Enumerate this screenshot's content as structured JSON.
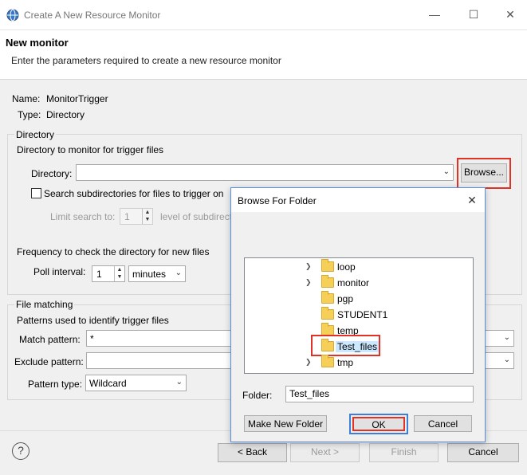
{
  "window": {
    "title": "Create A New Resource Monitor"
  },
  "header": {
    "title": "New monitor",
    "description": "Enter the parameters required to create a new resource monitor"
  },
  "info": {
    "name_label": "Name:",
    "name_value": "MonitorTrigger",
    "type_label": "Type:",
    "type_value": "Directory"
  },
  "directory": {
    "group_label": "Directory",
    "subtitle": "Directory to monitor for trigger files",
    "directory_label": "Directory:",
    "directory_value": "",
    "browse_label": "Browse...",
    "search_sub_label": "Search subdirectories for files to trigger on",
    "limit_label": "Limit search to:",
    "limit_value": "1",
    "level_label": "level of subdirect"
  },
  "frequency": {
    "subtitle": "Frequency to check the directory for new files",
    "poll_label": "Poll interval:",
    "poll_value": "1",
    "unit_value": "minutes"
  },
  "file_matching": {
    "group_label": "File matching",
    "subtitle": "Patterns used to identify trigger files",
    "match_label": "Match pattern:",
    "match_value": "*",
    "exclude_label": "Exclude pattern:",
    "exclude_value": "",
    "type_label": "Pattern type:",
    "type_value": "Wildcard"
  },
  "footer": {
    "back_label": "< Back",
    "next_label": "Next >",
    "finish_label": "Finish",
    "cancel_label": "Cancel"
  },
  "browse_dialog": {
    "title": "Browse For Folder",
    "folders": [
      {
        "name": "loop",
        "expandable": true
      },
      {
        "name": "monitor",
        "expandable": true
      },
      {
        "name": "pgp",
        "expandable": false
      },
      {
        "name": "STUDENT1",
        "expandable": false
      },
      {
        "name": "temp",
        "expandable": false
      },
      {
        "name": "Test_files",
        "expandable": false,
        "selected": true
      },
      {
        "name": "tmp",
        "expandable": true
      }
    ],
    "folder_label": "Folder:",
    "folder_value": "Test_files",
    "make_new_folder_label": "Make New Folder",
    "ok_label": "OK",
    "cancel_label": "Cancel"
  },
  "colors": {
    "highlight": "#e03326",
    "selection": "#cce8ff",
    "folder": "#f6cf59"
  }
}
